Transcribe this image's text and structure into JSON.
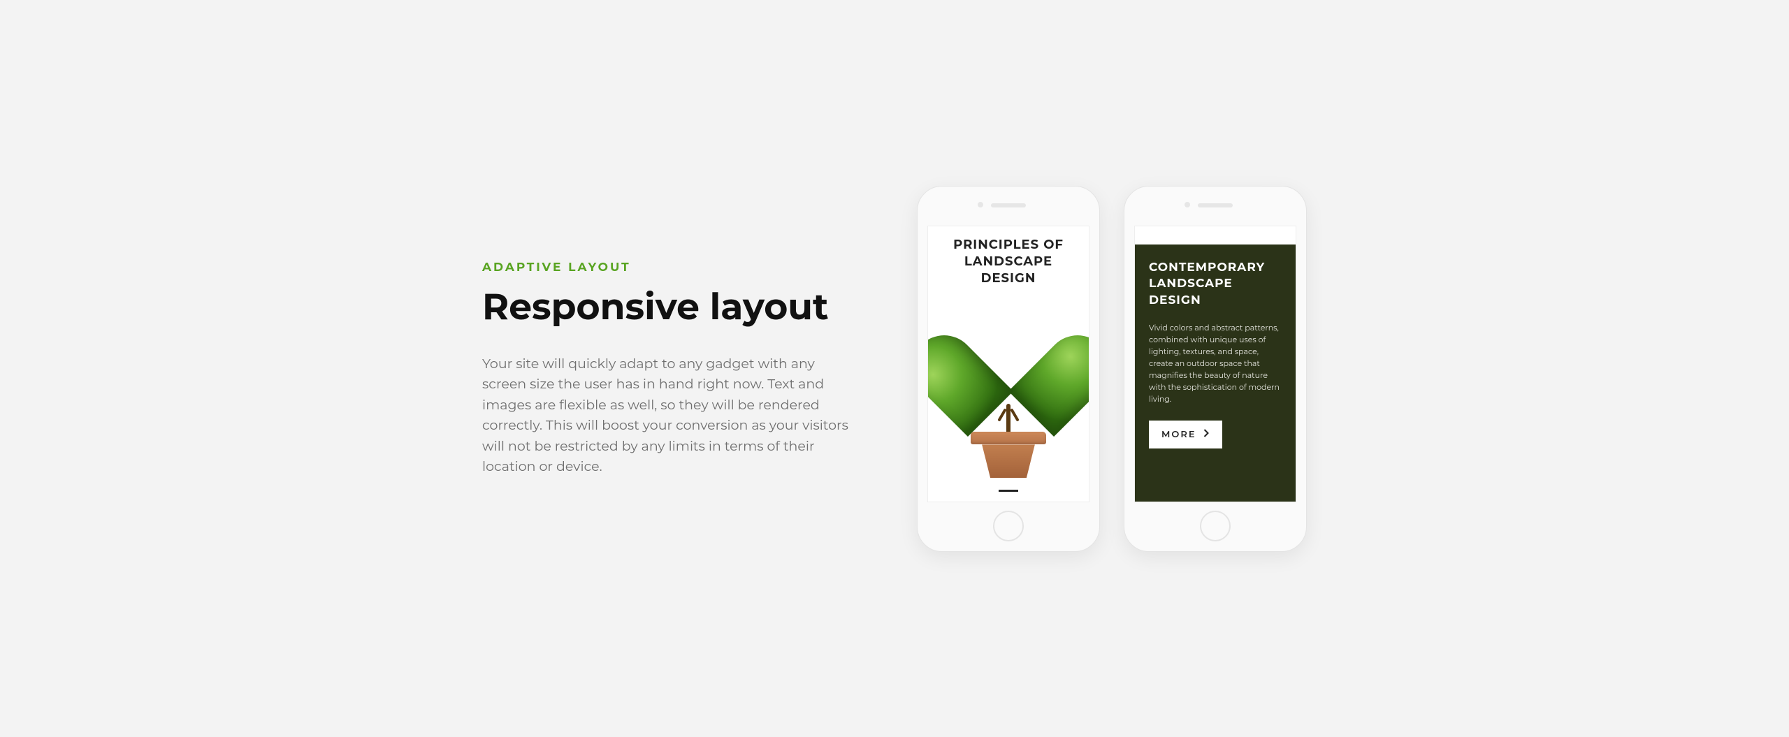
{
  "colors": {
    "accent": "#59a422",
    "panel": "#2b3318"
  },
  "left": {
    "eyebrow": "ADAPTIVE LAYOUT",
    "headline": "Responsive layout",
    "body": "Your site will quickly adapt to any gadget with any screen size the user has in hand right now. Text and images are flexible as well, so they will be rendered correctly. This will boost your conversion as your visitors will not be restricted by any limits in terms of their location or device."
  },
  "phone1": {
    "title_line1": "PRINCIPLES OF",
    "title_line2": "LANDSCAPE",
    "title_line3": "DESIGN"
  },
  "phone2": {
    "title_line1": "CONTEMPORARY",
    "title_line2": "LANDSCAPE",
    "title_line3": "DESIGN",
    "body": "Vivid colors and abstract patterns, combined with unique uses of lighting, textures, and space, create an outdoor space that magnifies the beauty of nature with the sophistication of modern living.",
    "cta": "MORE"
  }
}
